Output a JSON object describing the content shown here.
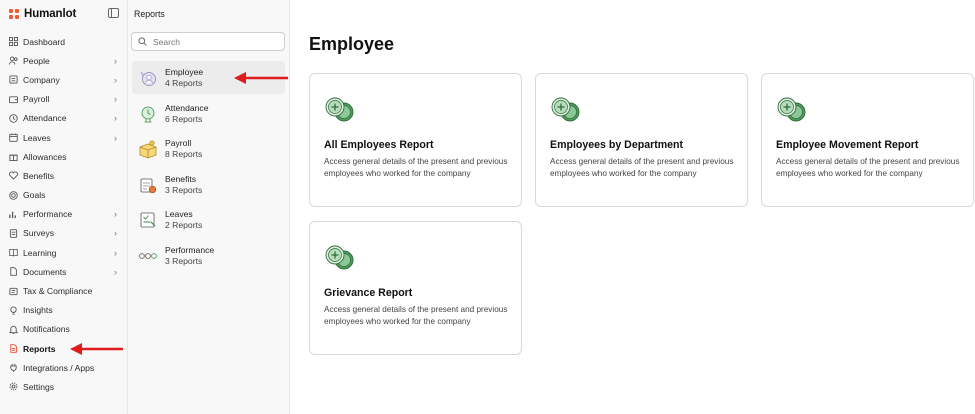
{
  "brand": {
    "name": "Humanlot",
    "accent": "#ef5b3a"
  },
  "nav": {
    "items": [
      {
        "label": "Dashboard",
        "icon": "grid-icon",
        "chevron": false,
        "active": false
      },
      {
        "label": "People",
        "icon": "people-icon",
        "chevron": true,
        "active": false
      },
      {
        "label": "Company",
        "icon": "building-icon",
        "chevron": true,
        "active": false
      },
      {
        "label": "Payroll",
        "icon": "wallet-icon",
        "chevron": true,
        "active": false
      },
      {
        "label": "Attendance",
        "icon": "clock-icon",
        "chevron": true,
        "active": false
      },
      {
        "label": "Leaves",
        "icon": "calendar-icon",
        "chevron": true,
        "active": false
      },
      {
        "label": "Allowances",
        "icon": "gift-icon",
        "chevron": false,
        "active": false
      },
      {
        "label": "Benefits",
        "icon": "heart-icon",
        "chevron": false,
        "active": false
      },
      {
        "label": "Goals",
        "icon": "target-icon",
        "chevron": false,
        "active": false
      },
      {
        "label": "Performance",
        "icon": "chart-icon",
        "chevron": true,
        "active": false
      },
      {
        "label": "Surveys",
        "icon": "survey-icon",
        "chevron": true,
        "active": false
      },
      {
        "label": "Learning",
        "icon": "book-icon",
        "chevron": true,
        "active": false
      },
      {
        "label": "Documents",
        "icon": "document-icon",
        "chevron": true,
        "active": false
      },
      {
        "label": "Tax & Compliance",
        "icon": "receipt-icon",
        "chevron": false,
        "active": false
      },
      {
        "label": "Insights",
        "icon": "lightbulb-icon",
        "chevron": false,
        "active": false
      },
      {
        "label": "Notifications",
        "icon": "bell-icon",
        "chevron": false,
        "active": false
      },
      {
        "label": "Reports",
        "icon": "report-icon",
        "chevron": false,
        "active": true
      },
      {
        "label": "Integrations / Apps",
        "icon": "plug-icon",
        "chevron": false,
        "active": false
      },
      {
        "label": "Settings",
        "icon": "gear-icon",
        "chevron": false,
        "active": false
      }
    ]
  },
  "reports_panel": {
    "title": "Reports",
    "search_placeholder": "Search",
    "categories": [
      {
        "name": "Employee",
        "count": "4 Reports",
        "icon": "employee-icon",
        "selected": true
      },
      {
        "name": "Attendance",
        "count": "6 Reports",
        "icon": "attendance-icon",
        "selected": false
      },
      {
        "name": "Payroll",
        "count": "8 Reports",
        "icon": "payroll-icon",
        "selected": false
      },
      {
        "name": "Benefits",
        "count": "3 Reports",
        "icon": "benefits-icon",
        "selected": false
      },
      {
        "name": "Leaves",
        "count": "2 Reports",
        "icon": "leaves-icon",
        "selected": false
      },
      {
        "name": "Performance",
        "count": "3 Reports",
        "icon": "performance-icon",
        "selected": false
      }
    ]
  },
  "main": {
    "title": "Employee",
    "cards": [
      {
        "title": "All Employees Report",
        "description": "Access general details of the present and previous employees who worked for the company",
        "icon": "coins-icon"
      },
      {
        "title": "Employees by Department",
        "description": "Access general details of the present and previous employees who worked for the company",
        "icon": "coins-icon"
      },
      {
        "title": "Employee Movement Report",
        "description": "Access general details of the present and previous employees who worked for the company",
        "icon": "coins-icon"
      },
      {
        "title": "Grievance Report",
        "description": "Access general details of the present and previous employees who worked for the company",
        "icon": "coins-icon"
      }
    ]
  },
  "annotations": {
    "arrow_color": "#e01b1b"
  }
}
